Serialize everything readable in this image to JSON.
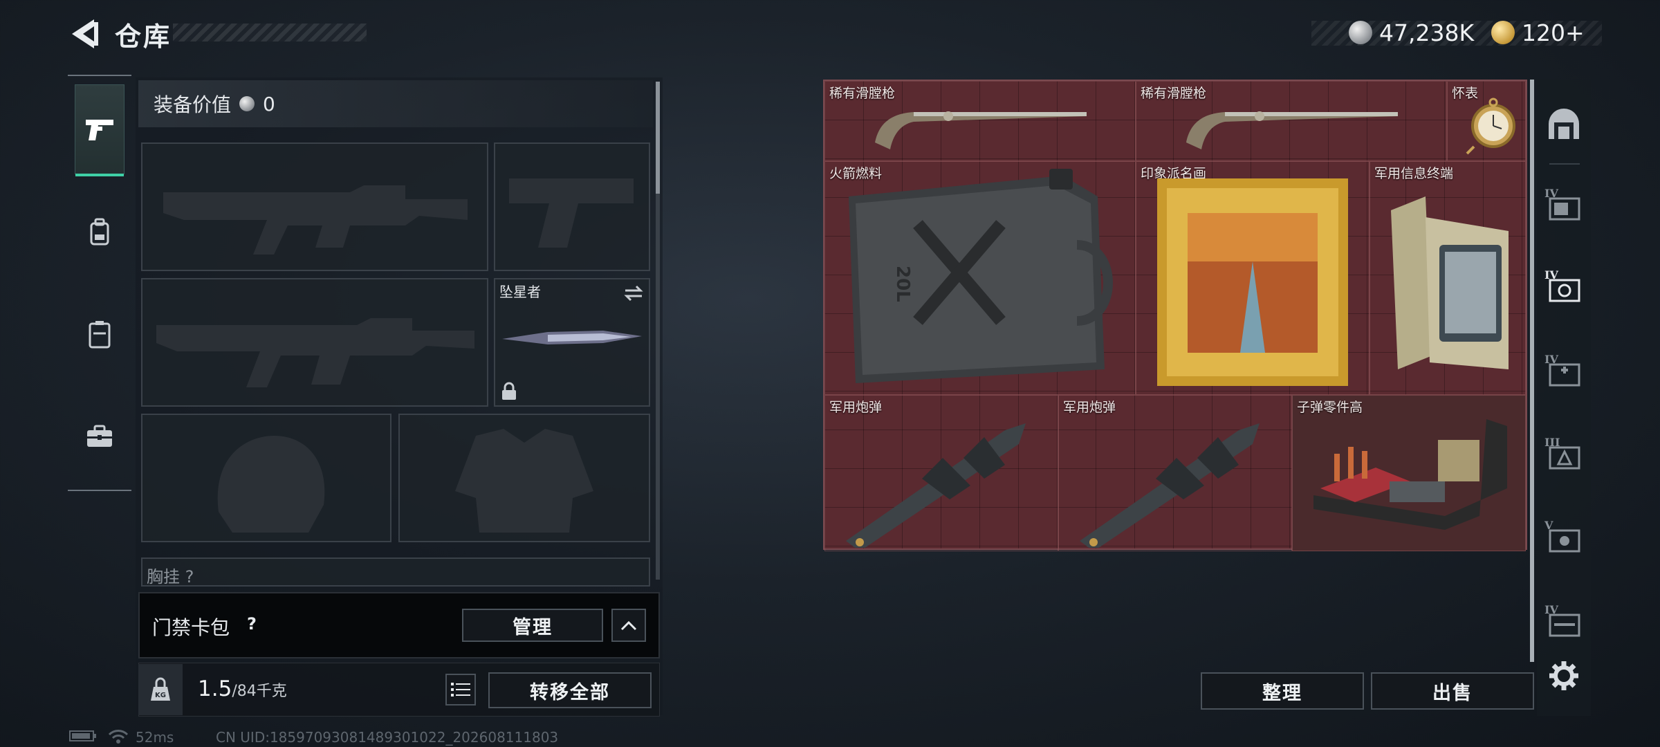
{
  "header": {
    "title": "仓库",
    "currency": [
      {
        "icon": "silver-coin-icon",
        "value": "47,238K"
      },
      {
        "icon": "gold-coin-icon",
        "value": "120+"
      }
    ]
  },
  "left_tabs": [
    {
      "name": "weapons",
      "icon": "pistol-icon",
      "active": true
    },
    {
      "name": "backpack",
      "icon": "backpack-icon",
      "active": false
    },
    {
      "name": "chest-rig",
      "icon": "chest-rig-icon",
      "active": false
    },
    {
      "name": "case",
      "icon": "briefcase-icon",
      "active": false
    }
  ],
  "equipment": {
    "label": "装备价值",
    "value": "0",
    "melee_slot_name": "坠星者",
    "partial_slot_label": "胸挂 ?"
  },
  "keycard": {
    "label": "门禁卡包",
    "help": "?",
    "manage_label": "管理"
  },
  "weight": {
    "icon_text": "KG",
    "current": "1.5",
    "max": "/84千克",
    "transfer_all_label": "转移全部"
  },
  "storage_items": [
    {
      "label": "稀有滑膛枪"
    },
    {
      "label": "稀有滑膛枪"
    },
    {
      "label": "怀表"
    },
    {
      "label": "火箭燃料"
    },
    {
      "label": "印象派名画"
    },
    {
      "label": "军用信息终端"
    },
    {
      "label": "军用炮弹"
    },
    {
      "label": "军用炮弹"
    },
    {
      "label": "子弹零件高"
    }
  ],
  "fuel_can_text": "20L",
  "categories": [
    {
      "icon": "safe-house-icon",
      "tier": ""
    },
    {
      "icon": "container-icon",
      "tier": "IV"
    },
    {
      "icon": "valuables-icon",
      "tier": "IV"
    },
    {
      "icon": "medical-icon",
      "tier": "IV"
    },
    {
      "icon": "ammo-icon",
      "tier": "III"
    },
    {
      "icon": "loot-icon",
      "tier": "V"
    },
    {
      "icon": "weapon-crate-icon",
      "tier": "IV"
    }
  ],
  "actions": {
    "sort_label": "整理",
    "sell_label": "出售"
  },
  "status": {
    "ping": "52ms",
    "uid": "CN UID:18597093081489301022_202608111803"
  },
  "colors": {
    "accent": "#3fd0a6",
    "grid_bg": "#5a2a30"
  }
}
